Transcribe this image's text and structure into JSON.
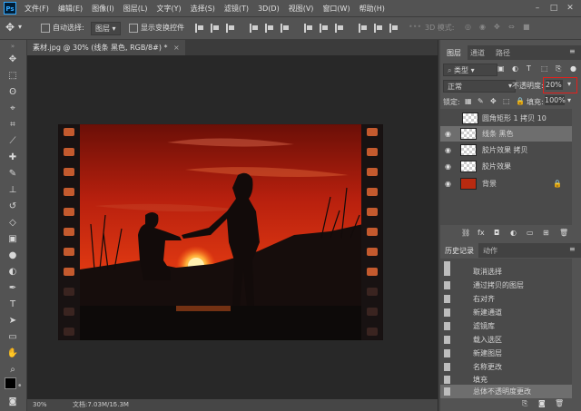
{
  "menubar": {
    "items": [
      "文件(F)",
      "编辑(E)",
      "图像(I)",
      "图层(L)",
      "文字(Y)",
      "选择(S)",
      "滤镜(T)",
      "3D(D)",
      "视图(V)",
      "窗口(W)",
      "帮助(H)"
    ]
  },
  "options": {
    "auto_select_label": "自动选择:",
    "auto_select_value": "图层",
    "transform_label": "显示变换控件",
    "mode_3d": "3D 模式:"
  },
  "document": {
    "tab_title": "素材.jpg @ 30% (线条 黑色, RGB/8#) *",
    "zoom": "30%",
    "doc_info": "文档:7.03M/15.3M"
  },
  "panels": {
    "layers_tab": "图层",
    "channels_tab": "通道",
    "paths_tab": "路径",
    "kind_label": "类型",
    "blend_mode": "正常",
    "opacity_label": "不透明度:",
    "opacity_value": "20%",
    "lock_label": "锁定:",
    "fill_label": "填充:",
    "fill_value": "100%",
    "layers": [
      {
        "name": "圆角矩形 1 拷贝 10",
        "visible": false
      },
      {
        "name": "线条 黑色",
        "visible": true
      },
      {
        "name": "胶片效果 拷贝",
        "visible": true
      },
      {
        "name": "胶片效果",
        "visible": true
      },
      {
        "name": "背景",
        "visible": true
      }
    ],
    "history_tab": "历史记录",
    "actions_tab": "动作",
    "history": [
      "",
      "取消选择",
      "通过拷贝的图层",
      "右对齐",
      "新建通道",
      "滤镜库",
      "载入选区",
      "新建图层",
      "名称更改",
      "填充",
      "总体不透明度更改"
    ]
  },
  "colors": {
    "accent_red": "#e2201c",
    "selected_row": "#6e6e6e",
    "panel_bg": "#535353"
  }
}
